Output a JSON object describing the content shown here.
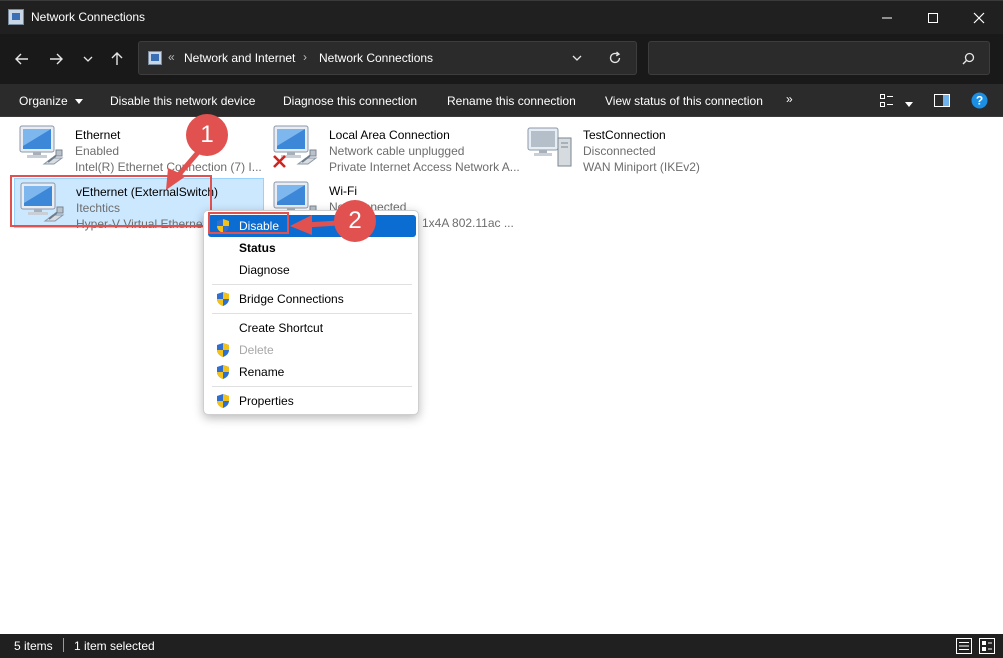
{
  "window": {
    "title": "Network Connections"
  },
  "address": {
    "overflow": "«",
    "crumbs": [
      "Network and Internet",
      "Network Connections"
    ],
    "separator": "›"
  },
  "search": {
    "placeholder": ""
  },
  "toolbar": {
    "organize": "Organize",
    "items": [
      "Disable this network device",
      "Diagnose this connection",
      "Rename this connection",
      "View status of this connection"
    ],
    "more": "»"
  },
  "connections": [
    {
      "name": "Ethernet",
      "status": "Enabled",
      "device": "Intel(R) Ethernet Connection (7) I..."
    },
    {
      "name": "Local Area Connection",
      "status": "Network cable unplugged",
      "device": "Private Internet Access Network A..."
    },
    {
      "name": "TestConnection",
      "status": "Disconnected",
      "device": "WAN Miniport (IKEv2)"
    },
    {
      "name": "vEthernet (ExternalSwitch)",
      "status": "Itechtics",
      "device": "Hyper-V Virtual Ethernet"
    },
    {
      "name": "Wi-Fi",
      "status": "Not connected",
      "device": "1x4A 802.11ac ..."
    }
  ],
  "context_menu": {
    "items": [
      "Disable",
      "Status",
      "Diagnose",
      "Bridge Connections",
      "Create Shortcut",
      "Delete",
      "Rename",
      "Properties"
    ]
  },
  "annotations": [
    "1",
    "2"
  ],
  "statusbar": {
    "count": "5 items",
    "selection": "1 item selected"
  },
  "colors": {
    "highlight_red": "#e05150",
    "selection_blue": "#0b6dd1",
    "selected_tile": "#cce8ff",
    "help_blue": "#1a8fe3"
  }
}
